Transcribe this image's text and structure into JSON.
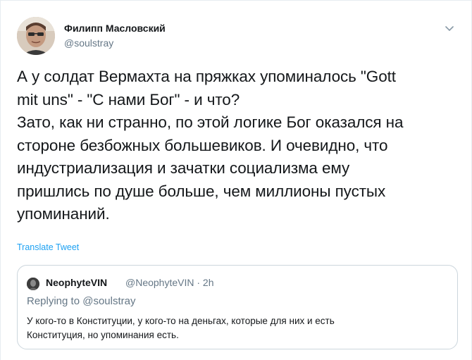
{
  "author": {
    "name": "Филипп Масловский",
    "handle": "@soulstray"
  },
  "tweet": {
    "text": "А у солдат Вермахта на пряжках упоминалось \"Gott\nmit uns\" - \"С нами Бог\" - и что?\nЗато, как ни странно, по этой логике Бог оказался на\nстороне безбожных большевиков. И очевидно, что\nиндустриализация и зачатки социализма ему\nпришлись по душе больше, чем миллионы пустых\nупоминаний.",
    "translate_label": "Translate Tweet"
  },
  "quote": {
    "name": "NeophyteVIN",
    "handle_time": "@NeophyteVIN · 2h",
    "replying_to": "Replying to @soulstray",
    "text": "У кого-то в Конституции, у кого-то на деньгах, которые для них и есть\nКонституция, но упоминания есть."
  },
  "icons": {
    "menu": "chevron-down-icon"
  },
  "colors": {
    "link": "#1da1f2",
    "secondary_text": "#657786",
    "border": "#ccd6dd"
  }
}
